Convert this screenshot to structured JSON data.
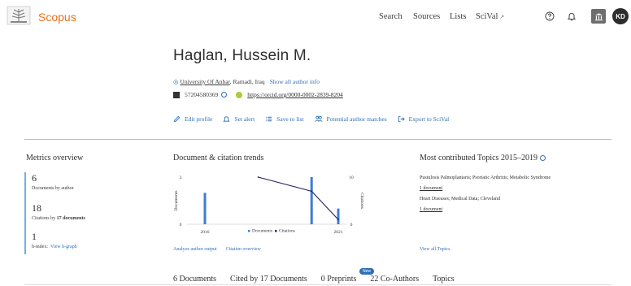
{
  "app": {
    "name": "Scopus"
  },
  "nav": {
    "search": "Search",
    "sources": "Sources",
    "lists": "Lists",
    "scival": "SciVal",
    "scival_ext": "↗"
  },
  "user": {
    "initials": "KD"
  },
  "colors": {
    "brand": "#e9711c",
    "link": "#2f6fb7",
    "documents_bar": "#3b7dd8",
    "citations_line": "#262262",
    "metrics_accent": "#6ab4e6"
  },
  "author": {
    "name": "Haglan, Hussein M.",
    "affiliation": "University Of Anbar",
    "location": ", Ramadi, Iraq",
    "all_info": "Show all author info",
    "scopus_id": "57204580369",
    "orcid": "https://orcid.org/0000-0002-2839-8204"
  },
  "actions": {
    "edit": "Edit profile",
    "alert": "Set alert",
    "save": "Save to list",
    "matches": "Potential author matches",
    "export": "Export to SciVal"
  },
  "metrics": {
    "title": "Metrics overview",
    "documents": "6",
    "documents_label": "Documents by author",
    "citations": "18",
    "citations_label_pre": "Citations by ",
    "citations_label_bold": "17 documents",
    "hindex": "1",
    "hindex_label": "h-index:",
    "hgraph": "View h-graph"
  },
  "trends": {
    "title": "Document & citation trends",
    "analyze": "Analyze author output",
    "overview": "Citation overview"
  },
  "chart_data": {
    "type": "bar",
    "x": [
      2016,
      2017,
      2018,
      2019,
      2020,
      2021
    ],
    "xticks": [
      "2016",
      "2021"
    ],
    "ylabel_left": "Documents",
    "ylabel_right": "Citations",
    "left_ticks": [
      "3",
      "0"
    ],
    "right_ticks": [
      "10",
      "0"
    ],
    "ylim_left": [
      0,
      3
    ],
    "ylim_right": [
      0,
      10
    ],
    "series": [
      {
        "name": "Documents",
        "type": "bar",
        "x": [
          2016,
          2020,
          2021
        ],
        "values": [
          2,
          3,
          1
        ]
      },
      {
        "name": "Citations",
        "type": "line",
        "x": [
          2018,
          2020,
          2021
        ],
        "values": [
          10,
          7,
          1
        ]
      }
    ],
    "legend": [
      "Documents",
      "Citations"
    ],
    "legend_position": "bottom"
  },
  "topics": {
    "title": "Most contributed Topics 2015–2019",
    "items": [
      {
        "name": "Pustulosis Palmoplantaris; Psoriatic Arthritis; Metabolic Syndrome",
        "docs": "1 document"
      },
      {
        "name": "Heart Diseases; Medical Data; Cleveland",
        "docs": "1 document"
      }
    ],
    "view_all": "View all Topics"
  },
  "tabs": {
    "documents": "6 Documents",
    "cited_by": "Cited by 17 Documents",
    "preprints": "0 Preprints",
    "new_badge": "New",
    "coauthors": "22 Co-Authors",
    "topics": "Topics"
  }
}
